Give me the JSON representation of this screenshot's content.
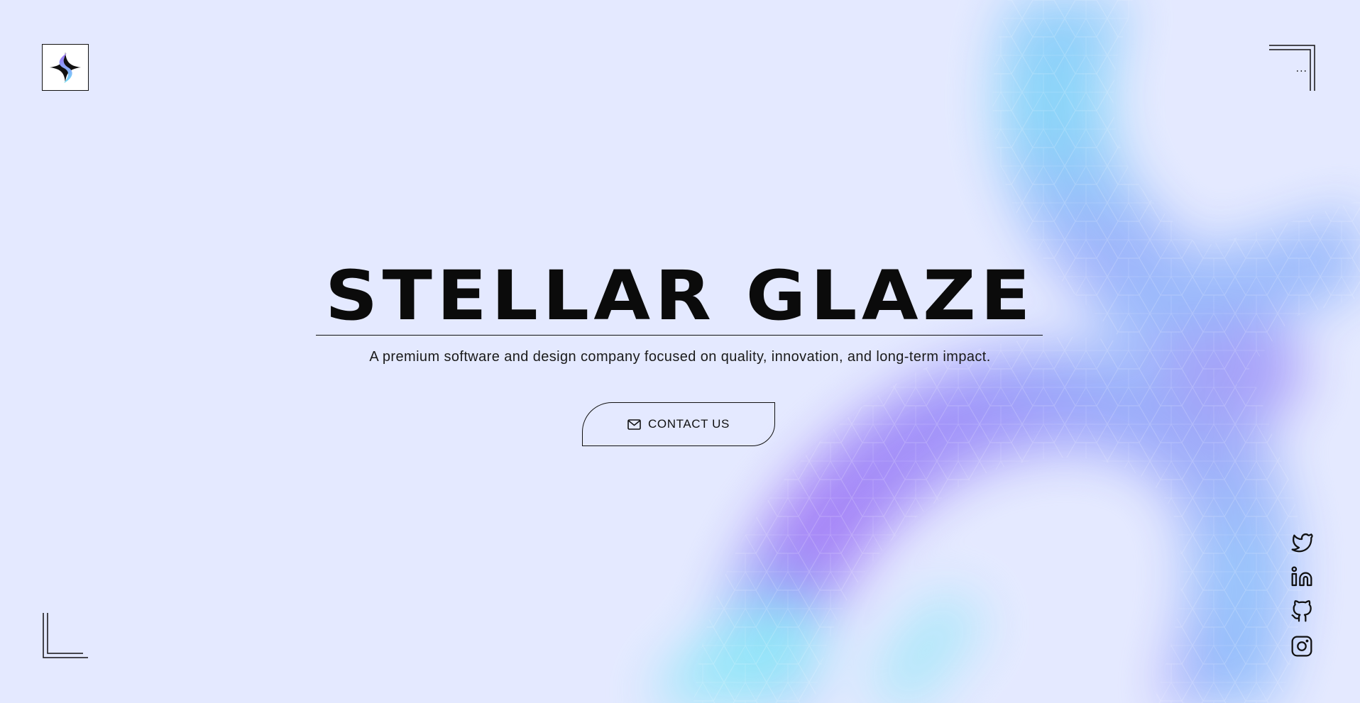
{
  "brand": {
    "name": "STELLAR GLAZE",
    "tagline": "A premium software and design company focused on quality, innovation, and long-term impact."
  },
  "header": {
    "logo_icon": "stellar-glaze-logo-icon",
    "menu_label": "..."
  },
  "cta": {
    "label": "CONTACT US",
    "icon": "mail-icon"
  },
  "socials": [
    {
      "icon": "twitter-icon"
    },
    {
      "icon": "linkedin-icon"
    },
    {
      "icon": "github-icon"
    },
    {
      "icon": "instagram-icon"
    }
  ],
  "colors": {
    "background": "#e4e9ff",
    "accent_purple": "#a27cf7",
    "accent_cyan": "#7fdcf8",
    "accent_blue": "#8fb8fb",
    "ink": "#111111"
  }
}
